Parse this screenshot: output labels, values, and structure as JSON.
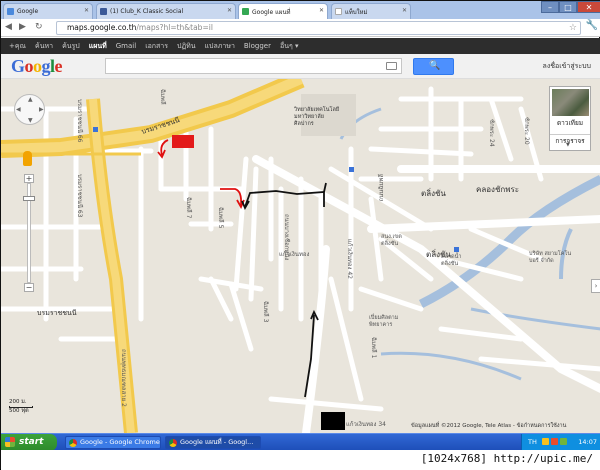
{
  "browser": {
    "tabs": [
      {
        "label": "Google",
        "favicon_color": "#4a89dc"
      },
      {
        "label": "(1) Club_K Classic Social",
        "favicon_color": "#3b5998"
      },
      {
        "label": "Google แผนที่",
        "favicon_color": "#34a853",
        "active": true
      },
      {
        "label": "แท็บใหม่",
        "favicon_color": "#ffffff"
      }
    ],
    "window_buttons": {
      "minimize": "–",
      "maximize": "□",
      "close": "✕"
    },
    "address": {
      "host": "maps.google.co.th",
      "path": "/maps?hl=th&tab=il"
    },
    "icons": {
      "back": "back-arrow-icon",
      "forward": "forward-arrow-icon",
      "reload": "reload-icon",
      "star": "star-icon",
      "wrench": "wrench-icon"
    }
  },
  "google_bar": {
    "items": [
      {
        "label": "+คุณ"
      },
      {
        "label": "ค้นหา"
      },
      {
        "label": "ค้นรูป"
      },
      {
        "label": "แผนที่",
        "active": true
      },
      {
        "label": "Gmail"
      },
      {
        "label": "เอกสาร"
      },
      {
        "label": "ปฏิทิน"
      },
      {
        "label": "แปลภาษา"
      },
      {
        "label": "Blogger"
      },
      {
        "label": "อื่นๆ ▾"
      }
    ]
  },
  "search": {
    "logo": "Google",
    "logo_colors": [
      "#3b6cd6",
      "#d93025",
      "#f4b400",
      "#3b6cd6",
      "#1e8e3e",
      "#d93025"
    ],
    "query": "",
    "button_icon": "search-icon",
    "signin_label": "ลงชื่อเข้าสู่ระบบ"
  },
  "map": {
    "labels": {
      "silpakorn": "วิทยาลัยเทคโนโลยี\nมหาวิทยาลัย\nศิลปากร",
      "taling_chan_main": "ตลิ่งชัน",
      "taling_chan_2": "ตลิ่งชัน",
      "khlong_chak_phra": "คลองชักพระ",
      "borommaratchachonnani_top": "บรมราชชนนี",
      "borommaratchachonnani_bottom": "บรมราชชนนี",
      "phutthamonthon_sai_2": "ถนนพุทธมณฑลสาย 2",
      "chimphli_road": "ถนนฉิมพลี",
      "soi_chimphli": "ฉิมพลี",
      "soi_7": "ฉิมพลี 7",
      "soi_5": "ฉิมพลี 5",
      "soi_3": "ฉิมพลี 3",
      "soi_1": "ฉิมพลี 1",
      "soi_42": "แก้วเงินทอง 42",
      "soi_34": "แก้วเงินทอง 34",
      "kaeo_ngoen_thong": "แก้วเงินทอง",
      "borommaratchachonnani_66": "บรมราชชนนี 66",
      "borommaratchachonnani_63": "บรมราชชนนี 63",
      "chak_phra": "ชักพระ 24",
      "chak_phra_20": "ชักพระ 20",
      "taling_chan_market": "ตลาดน้ำ\nตลิ่งชัน",
      "thaweewattana": "สนง.เขต\nตลิ่งชัน",
      "company": "บริษัท สยามโคโน\nบอรี จำกัด",
      "temple": "เปี่ยมศิลตาม\nพิทยาคาร",
      "bang_chueak_nang": "ถนนบางเชือกหนัง"
    },
    "controls": {
      "pan_icon": "pan-control-icon",
      "pegman_icon": "pegman-icon",
      "zoom_in": "+",
      "zoom_out": "−",
      "map_type_label": "ดาวเทียม",
      "traffic_label": "การจราจร",
      "collapse_label": "›"
    },
    "scale": {
      "metric": "200 ม.",
      "imperial": "500 ฟุต"
    },
    "copyright": "ข้อมูลแผนที่ ©2012 Google, Tele Atlas - ข้อกำหนดการใช้งาน"
  },
  "taskbar": {
    "start_label": "start",
    "tasks": [
      {
        "label": "Google - Google Chrome",
        "active": false
      },
      {
        "label": "Google แผนที่ - Googl...",
        "active": true
      }
    ],
    "tray": {
      "lang": "TH",
      "clock": "14:07"
    }
  },
  "watermark": "[1024x768] http://upic.me/"
}
